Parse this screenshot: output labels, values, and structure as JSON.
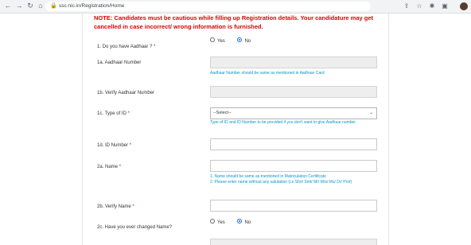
{
  "browser": {
    "url": "ssc.nic.in/Registration/Home"
  },
  "notice": "NOTE: Candidates must be cautious while filling up Registration details. Your candidature may get cancelled in case incorrect/ wrong information is furnished.",
  "form": {
    "q1": {
      "label": "1. Do you have Aadhaar ?",
      "required": "*",
      "yes": "Yes",
      "no": "No",
      "selected": "No"
    },
    "q1a": {
      "label": "1a. Aadhaar Number",
      "hint": "Aadhaar Number should be same as mentioned in Aadhaar Card"
    },
    "q1b": {
      "label": "1b. Verify Aadhaar Number"
    },
    "q1c": {
      "label": "1c. Type of ID",
      "required": "*",
      "selected": "--Select--",
      "hint": "Type of ID and ID Number to be provided if you don't want to give Aadhaar number"
    },
    "q1d": {
      "label": "1d. ID Number",
      "required": "*"
    },
    "q2a": {
      "label": "2a. Name",
      "required": "*",
      "hint1": "1. Name should be same as mentioned in Matriculation Certificate",
      "hint2": "2. Please enter name without any salutation (i.e Shri/ Smt/ Mr/ Mrs/ Ms/ Dr/ Prof)"
    },
    "q2b": {
      "label": "2b. Verify Name",
      "required": "*"
    },
    "q2c": {
      "label": "2c. Have you ever changed Name?",
      "yes": "Yes",
      "no": "No",
      "selected": "No"
    }
  }
}
